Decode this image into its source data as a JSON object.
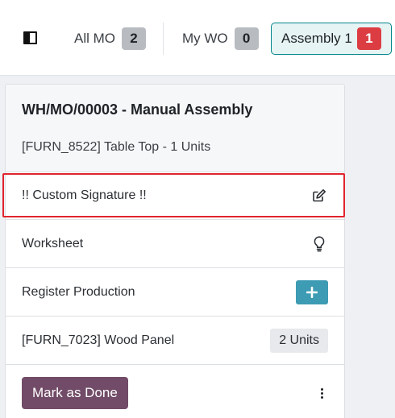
{
  "topbar": {
    "filters": [
      {
        "label": "All MO",
        "count": "2"
      },
      {
        "label": "My WO",
        "count": "0"
      },
      {
        "label": "Assembly 1",
        "count": "1"
      }
    ]
  },
  "card": {
    "title": "WH/MO/00003 - Manual Assembly",
    "subtitle": "[FURN_8522] Table Top - 1 Units",
    "rows": [
      {
        "label": "!! Custom Signature !!",
        "icon": "edit-icon"
      },
      {
        "label": "Worksheet",
        "icon": "lightbulb-icon"
      },
      {
        "label": "Register Production",
        "icon": "plus-icon"
      },
      {
        "label": "[FURN_7023] Wood Panel",
        "quantity": "2 Units"
      }
    ],
    "done_label": "Mark as Done"
  },
  "colors": {
    "accent_teal": "#00848a",
    "plus_button": "#3d9bb3",
    "done_button": "#714b67",
    "highlight_border": "#e0242d",
    "red_badge": "#dc3d43"
  }
}
